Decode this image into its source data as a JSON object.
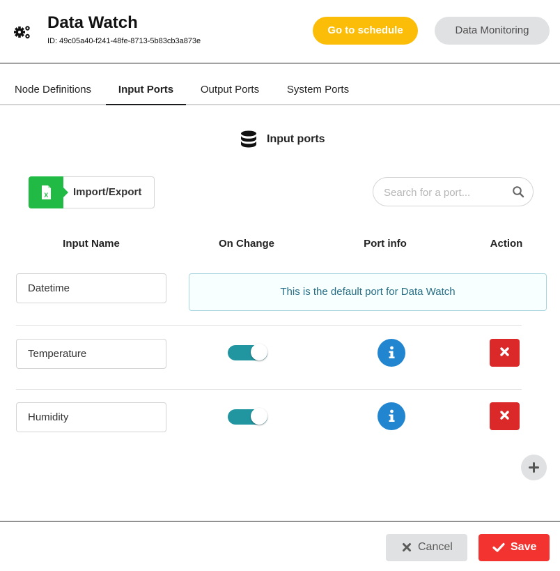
{
  "header": {
    "title": "Data Watch",
    "id_text": "ID: 49c05a40-f241-48fe-8713-5b83cb3a873e",
    "schedule_button": "Go to schedule",
    "monitoring_button": "Data Monitoring",
    "icon": "gears-icon"
  },
  "tabs": [
    {
      "label": "Node Definitions",
      "active": false
    },
    {
      "label": "Input Ports",
      "active": true
    },
    {
      "label": "Output Ports",
      "active": false
    },
    {
      "label": "System Ports",
      "active": false
    }
  ],
  "section": {
    "title": "Input ports",
    "icon": "database-icon"
  },
  "toolbar": {
    "import_export_label": "Import/Export",
    "import_icon": "excel-file-icon",
    "search_placeholder": "Search for a port..."
  },
  "table": {
    "headers": [
      "Input Name",
      "On Change",
      "Port info",
      "Action"
    ],
    "rows": [
      {
        "name": "Datetime",
        "default": true,
        "note": "This is the default port for Data Watch"
      },
      {
        "name": "Temperature",
        "default": false,
        "on_change": true
      },
      {
        "name": "Humidity",
        "default": false,
        "on_change": true
      }
    ]
  },
  "footer": {
    "cancel_label": "Cancel",
    "save_label": "Save"
  },
  "colors": {
    "schedule": "#fbbd08",
    "toggle_on": "#2196a0",
    "info": "#2185d0",
    "delete": "#db2828",
    "save": "#f2332f",
    "excel": "#21ba45"
  }
}
